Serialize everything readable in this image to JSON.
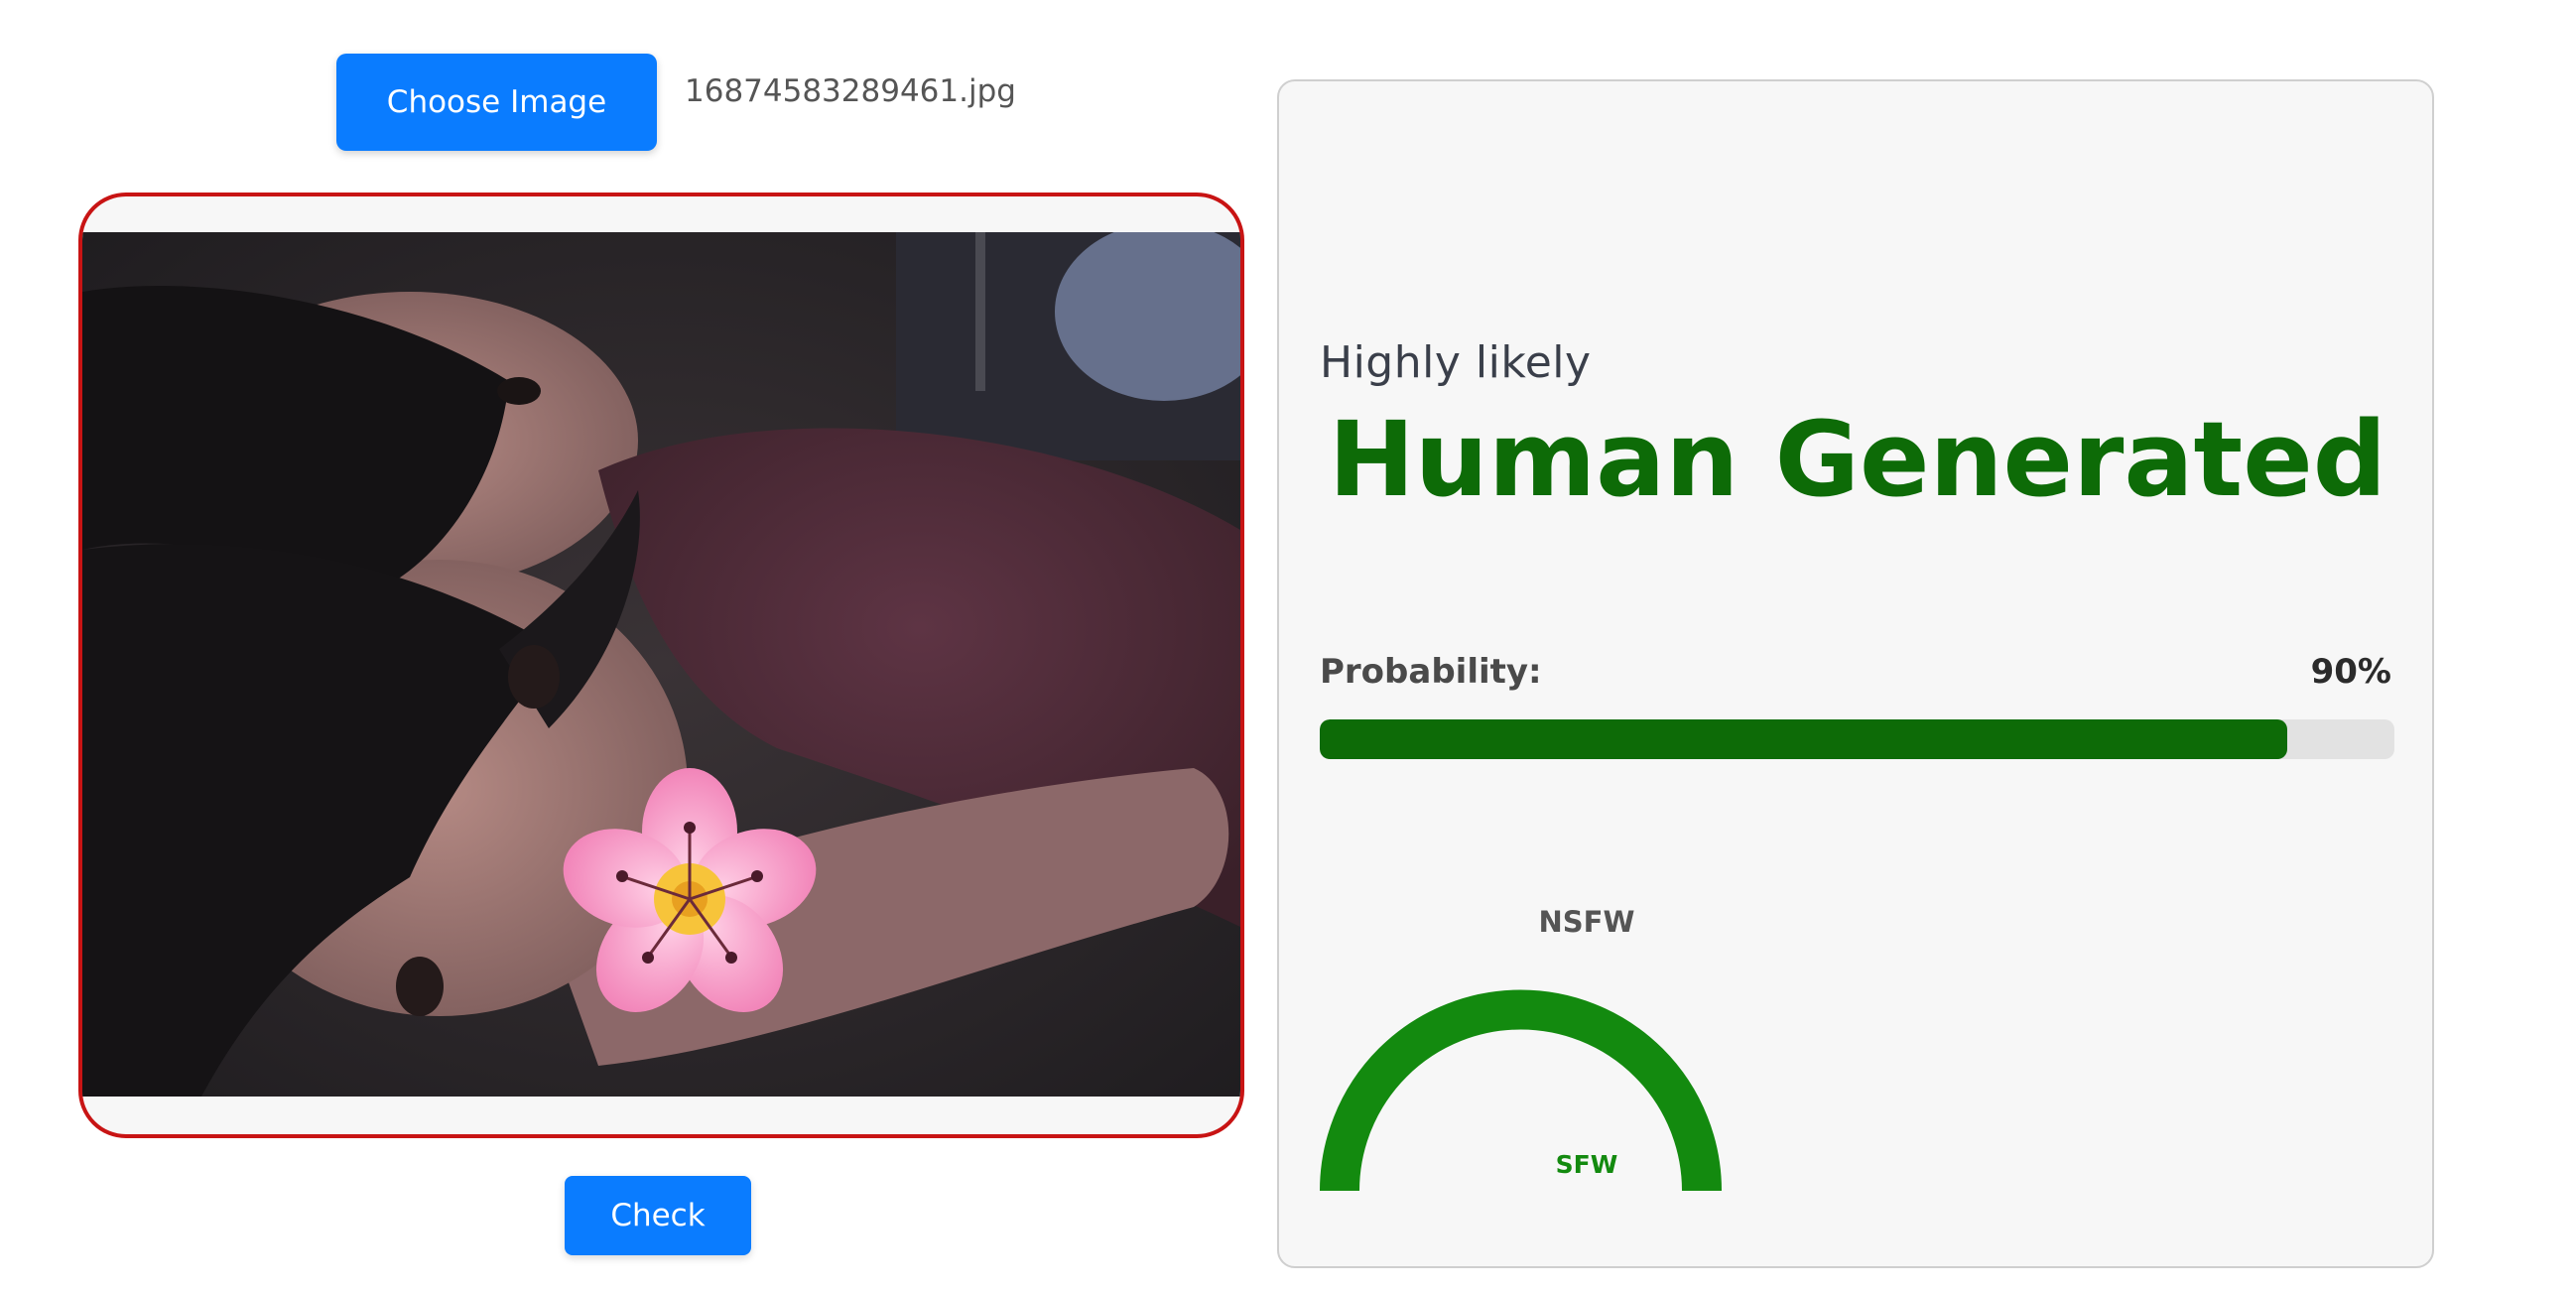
{
  "upload": {
    "choose_label": "Choose Image",
    "file_name": "16874583289461.jpg"
  },
  "preview": {
    "image_alt": "Uploaded photo preview"
  },
  "actions": {
    "check_label": "Check"
  },
  "result": {
    "likelihood": "Highly likely",
    "verdict": "Human Generated",
    "probability_label": "Probability:",
    "probability_text": "90%",
    "probability_value": 0.9,
    "gauge_top_label": "NSFW",
    "gauge_bottom_label": "SFW"
  },
  "colors": {
    "accent_button": "#0a7cff",
    "verdict_green": "#0d6b07",
    "gauge_green": "#138a0f",
    "frame_red": "#c81414"
  }
}
